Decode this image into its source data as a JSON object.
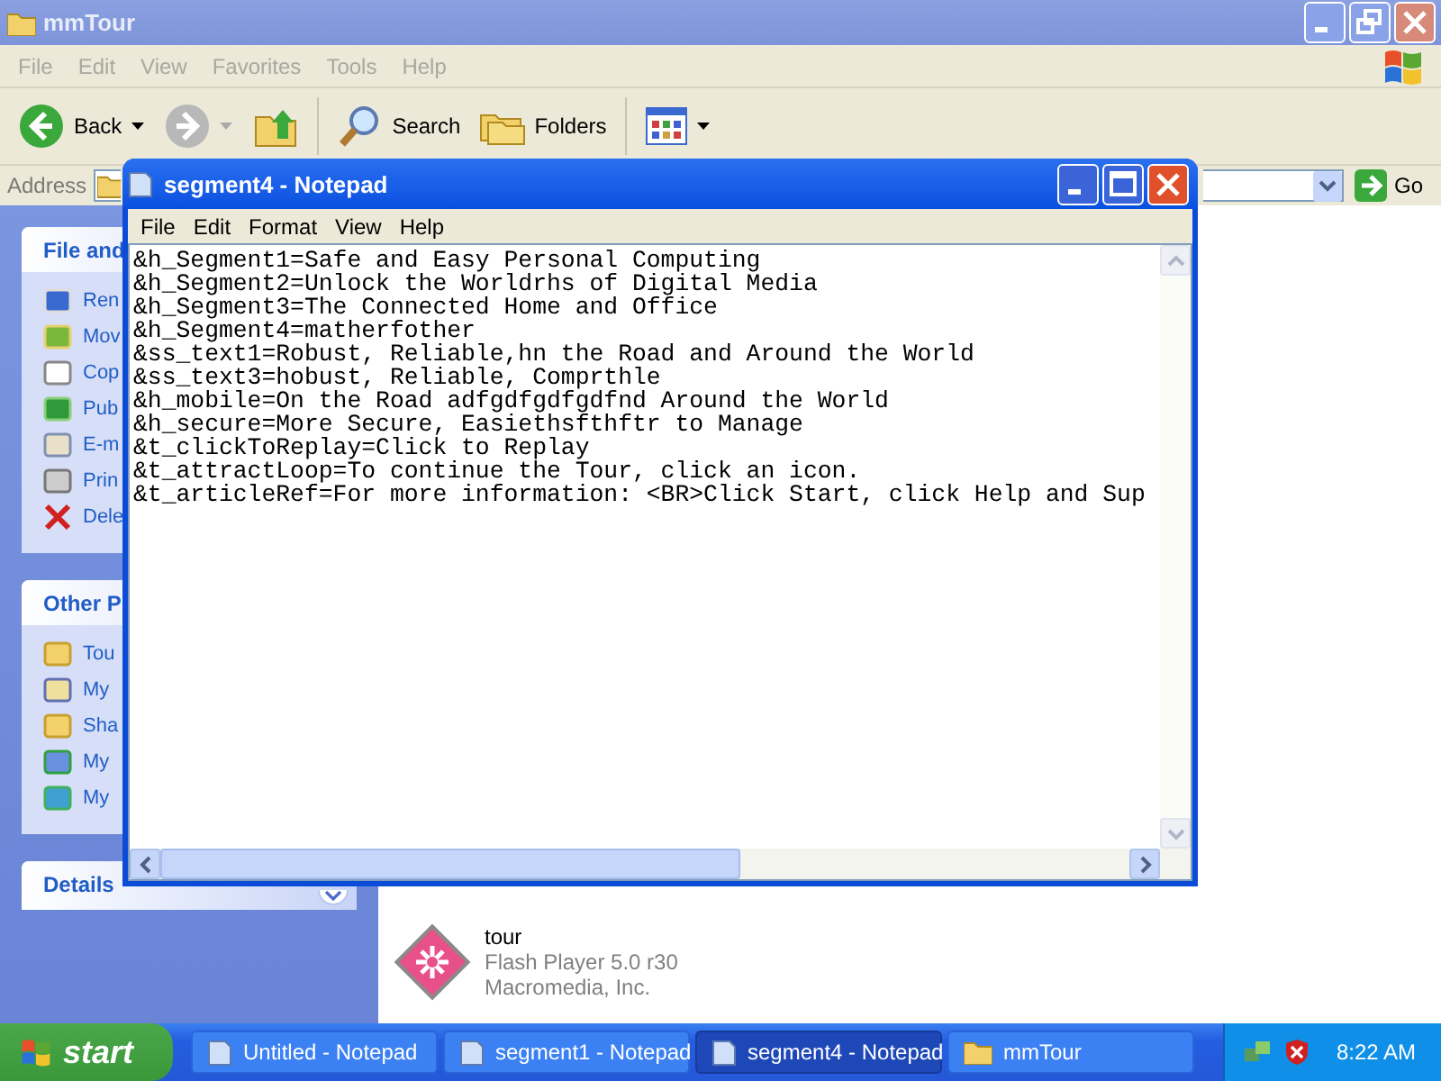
{
  "explorer": {
    "title": "mmTour",
    "menu": [
      "File",
      "Edit",
      "View",
      "Favorites",
      "Tools",
      "Help"
    ],
    "toolbar": {
      "back": "Back",
      "search": "Search",
      "folders": "Folders"
    },
    "address": {
      "label": "Address",
      "go": "Go"
    },
    "task_pane": [
      {
        "title": "File and",
        "items": [
          "Ren",
          "Mov",
          "Cop",
          "Pub",
          "E-m",
          "Prin",
          "Dele"
        ]
      },
      {
        "title": "Other P",
        "items": [
          "Tou",
          "My",
          "Sha",
          "My",
          "My"
        ]
      },
      {
        "title": "Details"
      }
    ],
    "files": [
      {
        "name": "tour",
        "type": "Flash Player 5.0 r30",
        "company": "Macromedia, Inc."
      }
    ]
  },
  "notepad": {
    "title": "segment4 - Notepad",
    "menu": [
      "File",
      "Edit",
      "Format",
      "View",
      "Help"
    ],
    "lines": [
      "&h_Segment1=Safe and Easy Personal Computing",
      "&h_Segment2=Unlock the Worldrhs of Digital Media",
      "&h_Segment3=The Connected Home and Office",
      "&h_Segment4=matherfother",
      "&ss_text1=Robust, Reliable,hn the Road and Around the World",
      "&ss_text3=hobust, Reliable, Comprthle",
      "&h_mobile=On the Road adfgdfgdfgdfnd Around the World",
      "&h_secure=More Secure, Easiethsfthftr to Manage",
      "&t_clickToReplay=Click to Replay",
      "&t_attractLoop=To continue the Tour, click an icon.",
      "&t_articleRef=For more information: <BR>Click Start, click Help and Sup"
    ]
  },
  "taskbar": {
    "start": "start",
    "tasks": [
      {
        "label": "Untitled - Notepad",
        "kind": "notepad",
        "selected": false
      },
      {
        "label": "segment1 - Notepad",
        "kind": "notepad",
        "selected": false
      },
      {
        "label": "segment4 - Notepad",
        "kind": "notepad",
        "selected": true
      },
      {
        "label": "mmTour",
        "kind": "folder",
        "selected": false
      }
    ],
    "clock": "8:22 AM"
  }
}
